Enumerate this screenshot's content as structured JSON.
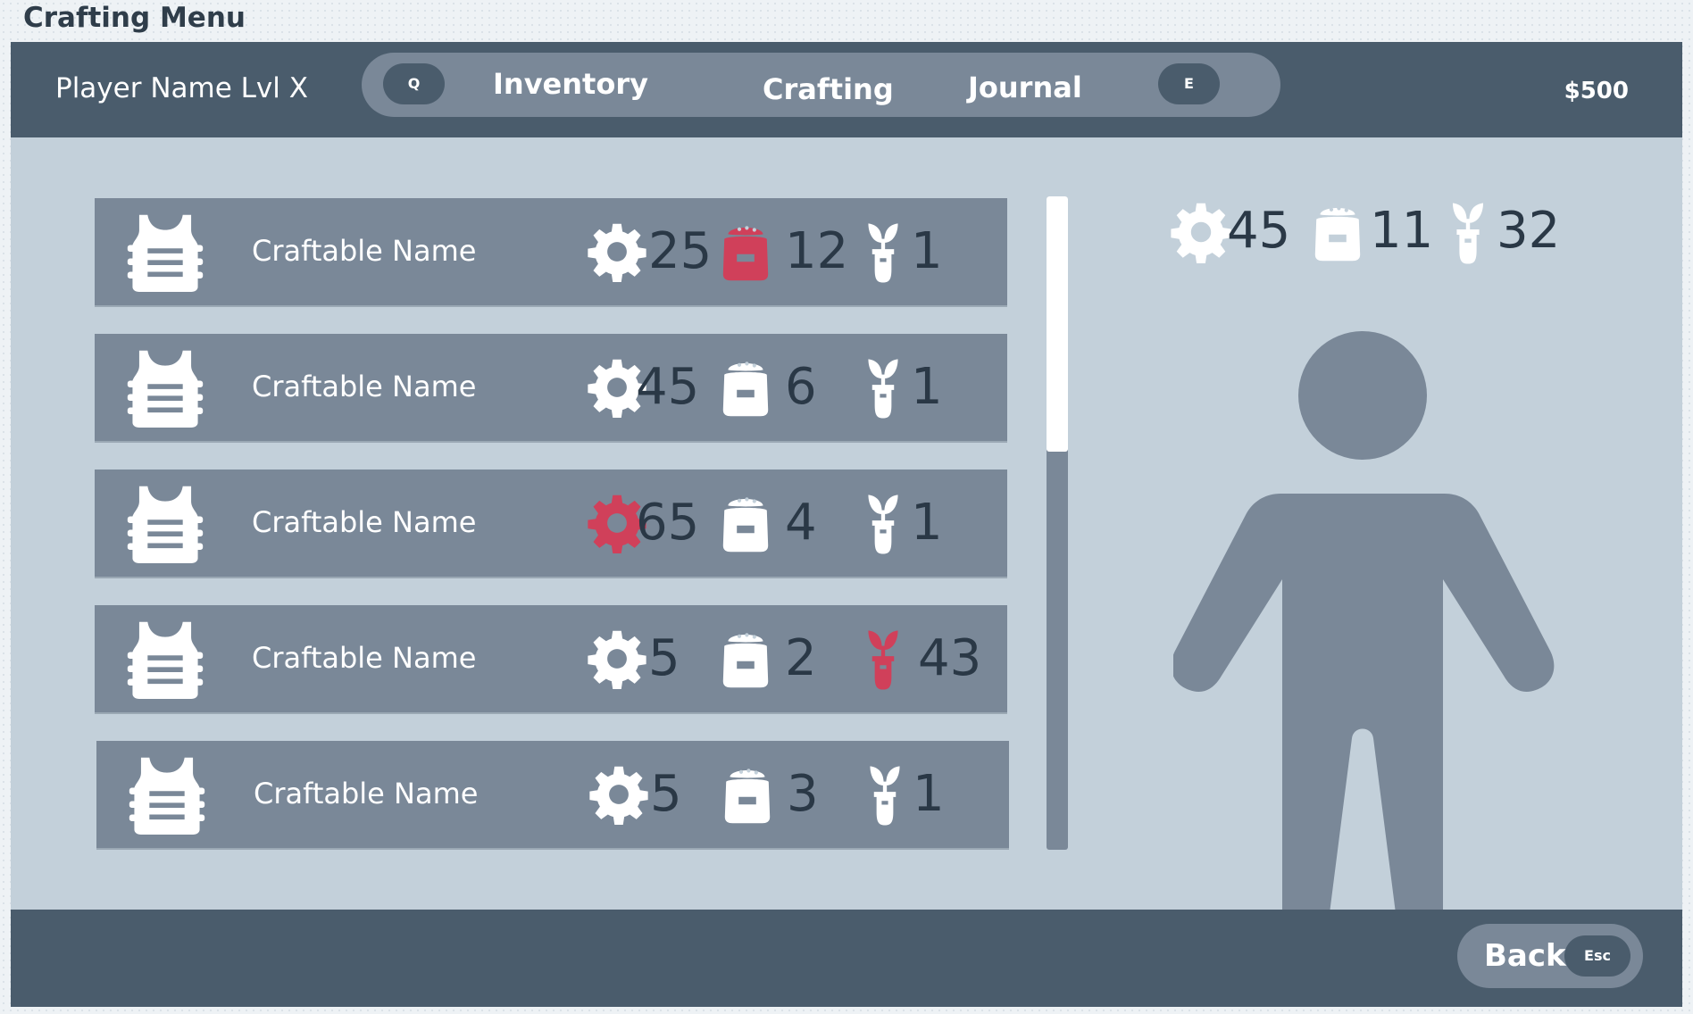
{
  "window": {
    "title": "Crafting Menu"
  },
  "header": {
    "player_name": "Player Name Lvl X",
    "tab_prev_key": "Q",
    "tab_next_key": "E",
    "tabs": [
      {
        "label": "Inventory",
        "active": false
      },
      {
        "label": "Crafting",
        "active": true
      },
      {
        "label": "Journal",
        "active": false
      }
    ],
    "money": "$500"
  },
  "resources": {
    "icons": [
      "gear-icon",
      "sack-icon",
      "seedling-icon"
    ],
    "normal_color": "#ffffff",
    "insufficient_color": "#d0405a"
  },
  "craftables": [
    {
      "name": "Craftable Name",
      "icon": "vest-armor-icon",
      "gear": "25",
      "sack": "12",
      "plant": "1",
      "insufficient": "sack"
    },
    {
      "name": "Craftable Name",
      "icon": "vest-armor-icon",
      "gear": "45",
      "sack": "6",
      "plant": "1",
      "insufficient": ""
    },
    {
      "name": "Craftable Name",
      "icon": "vest-armor-icon",
      "gear": "65",
      "sack": "4",
      "plant": "1",
      "insufficient": "gear"
    },
    {
      "name": "Craftable Name",
      "icon": "vest-armor-icon",
      "gear": "5",
      "sack": "2",
      "plant": "43",
      "insufficient": "plant"
    },
    {
      "name": "Craftable Name",
      "icon": "vest-armor-icon",
      "gear": "5",
      "sack": "3",
      "plant": "1",
      "insufficient": ""
    }
  ],
  "scrollbar": {
    "position": 0.0,
    "visible_fraction": 0.39
  },
  "inventory_totals": {
    "gear": "45",
    "sack": "11",
    "plant": "32"
  },
  "footer": {
    "back_label": "Back",
    "back_key": "Esc"
  },
  "colors": {
    "bar": "#4a5c6c",
    "panel": "#c3d0da",
    "row": "#7a8898",
    "text_dark": "#2a3846",
    "alert": "#d0405a"
  }
}
